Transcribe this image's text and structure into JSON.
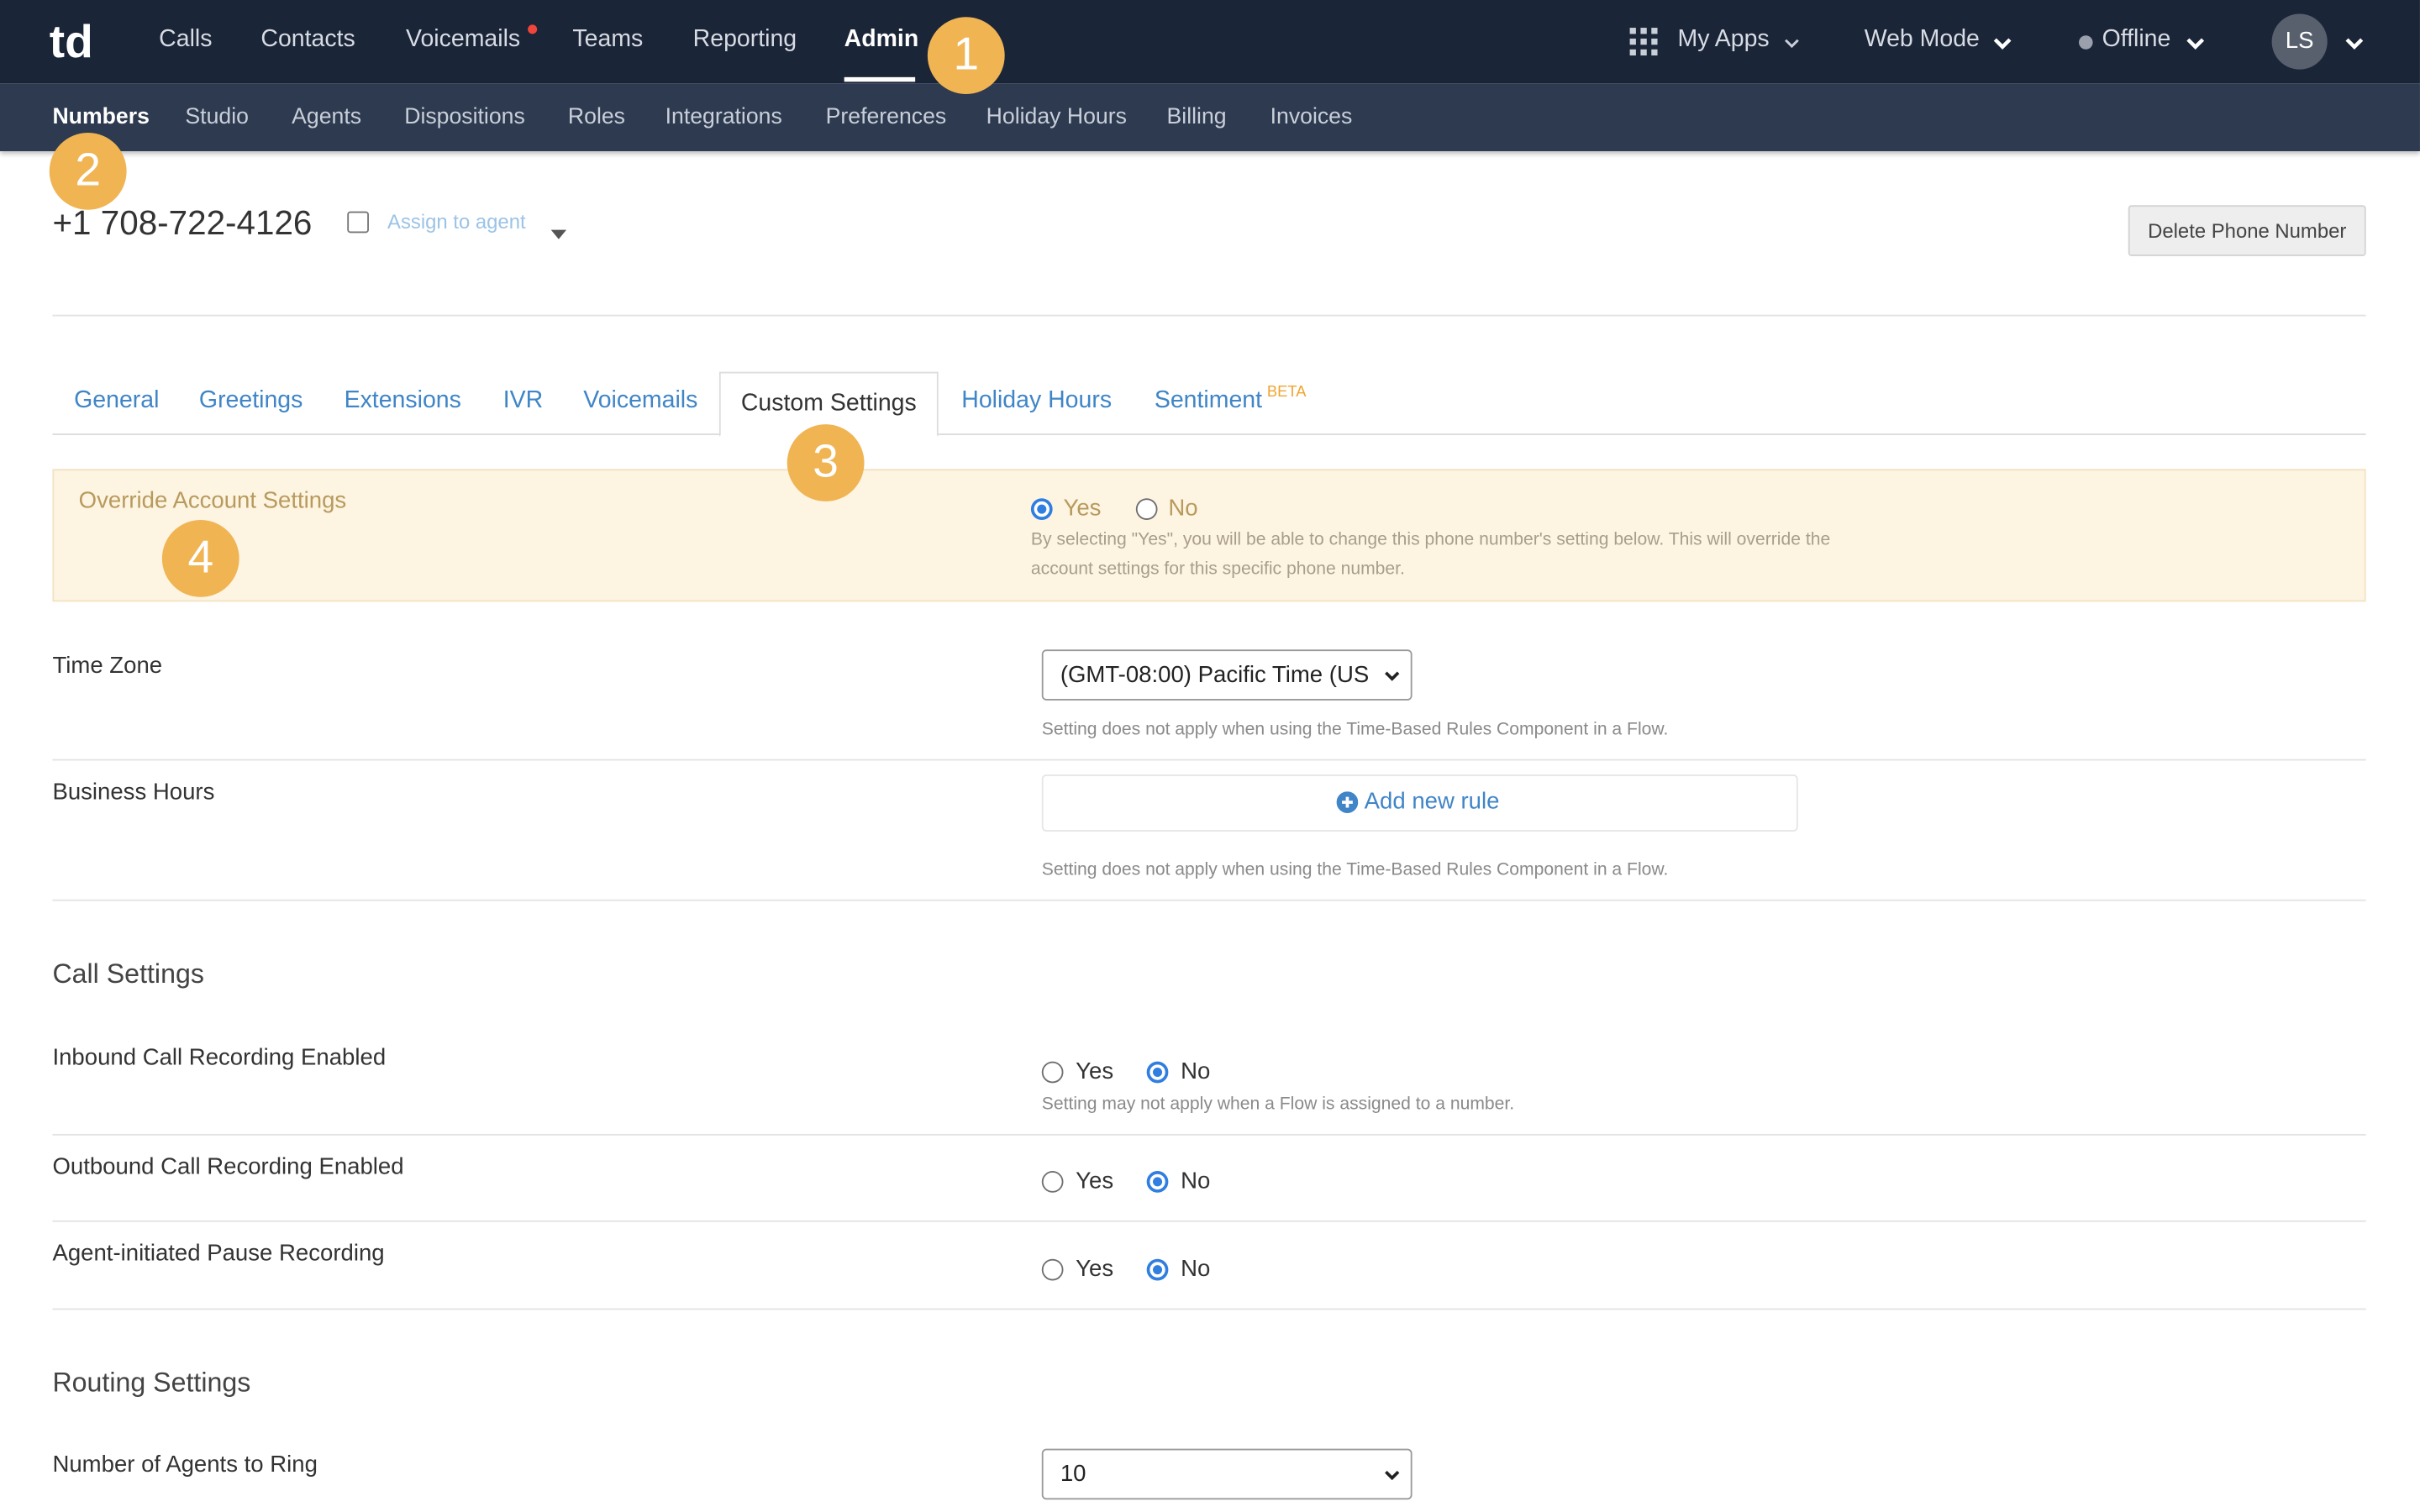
{
  "top_nav": {
    "logo_text": "td",
    "items": [
      "Calls",
      "Contacts",
      "Voicemails",
      "Teams",
      "Reporting",
      "Admin"
    ],
    "active": "Admin",
    "my_apps": "My Apps",
    "web_mode": "Web Mode",
    "status": "Offline",
    "avatar_initials": "LS"
  },
  "sub_nav": {
    "items": [
      "Numbers",
      "Studio",
      "Agents",
      "Dispositions",
      "Roles",
      "Integrations",
      "Preferences",
      "Holiday Hours",
      "Billing",
      "Invoices"
    ],
    "active": "Numbers"
  },
  "markers": [
    "1",
    "2",
    "3",
    "4"
  ],
  "header": {
    "phone_number": "+1 708-722-4126",
    "assign_label": "Assign to agent",
    "delete_button": "Delete Phone Number"
  },
  "tabs": {
    "items": [
      "General",
      "Greetings",
      "Extensions",
      "IVR",
      "Voicemails",
      "Custom Settings",
      "Holiday Hours",
      "Sentiment"
    ],
    "active": "Custom Settings",
    "beta_badge": "BETA"
  },
  "override": {
    "label": "Override Account Settings",
    "yes": "Yes",
    "no": "No",
    "selected": "Yes",
    "help_line1": "By selecting \"Yes\", you will be able to change this phone number's setting below. This will override the",
    "help_line2": "account settings for this specific phone number."
  },
  "time_zone": {
    "label": "Time Zone",
    "value": "(GMT-08:00) Pacific Time (US",
    "help": "Setting does not apply when using the Time-Based Rules Component in a Flow."
  },
  "business_hours": {
    "label": "Business Hours",
    "add_rule": "Add new rule",
    "help": "Setting does not apply when using the Time-Based Rules Component in a Flow."
  },
  "call_settings": {
    "heading": "Call Settings",
    "inbound": {
      "label": "Inbound Call Recording Enabled",
      "yes": "Yes",
      "no": "No",
      "selected": "No",
      "help": "Setting may not apply when a Flow is assigned to a number."
    },
    "outbound": {
      "label": "Outbound Call Recording Enabled",
      "yes": "Yes",
      "no": "No",
      "selected": "No"
    },
    "pause": {
      "label": "Agent-initiated Pause Recording",
      "yes": "Yes",
      "no": "No",
      "selected": "No"
    }
  },
  "routing_settings": {
    "heading": "Routing Settings",
    "agents_to_ring": {
      "label": "Number of Agents to Ring",
      "value": "10"
    }
  },
  "colors": {
    "topbar": "#1b2538",
    "subbar": "#2d3a50",
    "link_blue": "#3f85c7",
    "marker_orange": "#f0b453",
    "override_bg": "#fdf4e2",
    "radio_blue": "#2f7ee0"
  }
}
